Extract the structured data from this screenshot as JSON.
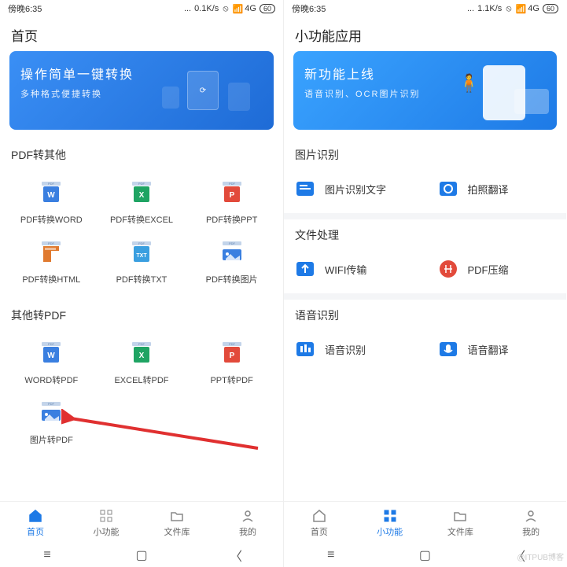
{
  "status": {
    "time": "傍晚6:35",
    "net_l": "0.1K/s",
    "net_r": "1.1K/s",
    "signal": "4G",
    "battery": "60"
  },
  "left": {
    "title": "首页",
    "banner": {
      "title": "操作简单一键转换",
      "sub": "多种格式便捷转换"
    },
    "sec1": "PDF转其他",
    "tools1": [
      {
        "label": "PDF转换WORD",
        "color": "#3a7fe0",
        "tag": "W"
      },
      {
        "label": "PDF转换EXCEL",
        "color": "#1fa463",
        "tag": "X"
      },
      {
        "label": "PDF转换PPT",
        "color": "#e24a3b",
        "tag": "P"
      },
      {
        "label": "PDF转换HTML",
        "color": "#e07a2f",
        "tag": "H"
      },
      {
        "label": "PDF转换TXT",
        "color": "#3a9fe0",
        "tag": "TXT"
      },
      {
        "label": "PDF转换图片",
        "color": "#3a7fe0",
        "tag": "img"
      }
    ],
    "sec2": "其他转PDF",
    "tools2": [
      {
        "label": "WORD转PDF",
        "color": "#3a7fe0",
        "tag": "W"
      },
      {
        "label": "EXCEL转PDF",
        "color": "#1fa463",
        "tag": "X"
      },
      {
        "label": "PPT转PDF",
        "color": "#e24a3b",
        "tag": "P"
      },
      {
        "label": "图片转PDF",
        "color": "#3a7fe0",
        "tag": "img"
      }
    ]
  },
  "right": {
    "title": "小功能应用",
    "banner": {
      "title": "新功能上线",
      "sub": "语音识别、OCR图片识别"
    },
    "sec1": "图片识别",
    "group1": [
      {
        "label": "图片识别文字",
        "color": "#1e7ae6"
      },
      {
        "label": "拍照翻译",
        "color": "#1e7ae6"
      }
    ],
    "sec2": "文件处理",
    "group2": [
      {
        "label": "WIFI传输",
        "color": "#1e7ae6"
      },
      {
        "label": "PDF压缩",
        "color": "#e24a3b"
      }
    ],
    "sec3": "语音识别",
    "group3": [
      {
        "label": "语音识别",
        "color": "#1e7ae6"
      },
      {
        "label": "语音翻译",
        "color": "#1e7ae6"
      }
    ]
  },
  "nav": {
    "items": [
      {
        "label": "首页",
        "icon": "home"
      },
      {
        "label": "小功能",
        "icon": "grid"
      },
      {
        "label": "文件库",
        "icon": "folder"
      },
      {
        "label": "我的",
        "icon": "user"
      }
    ]
  },
  "watermark": "@ITPUB博客"
}
